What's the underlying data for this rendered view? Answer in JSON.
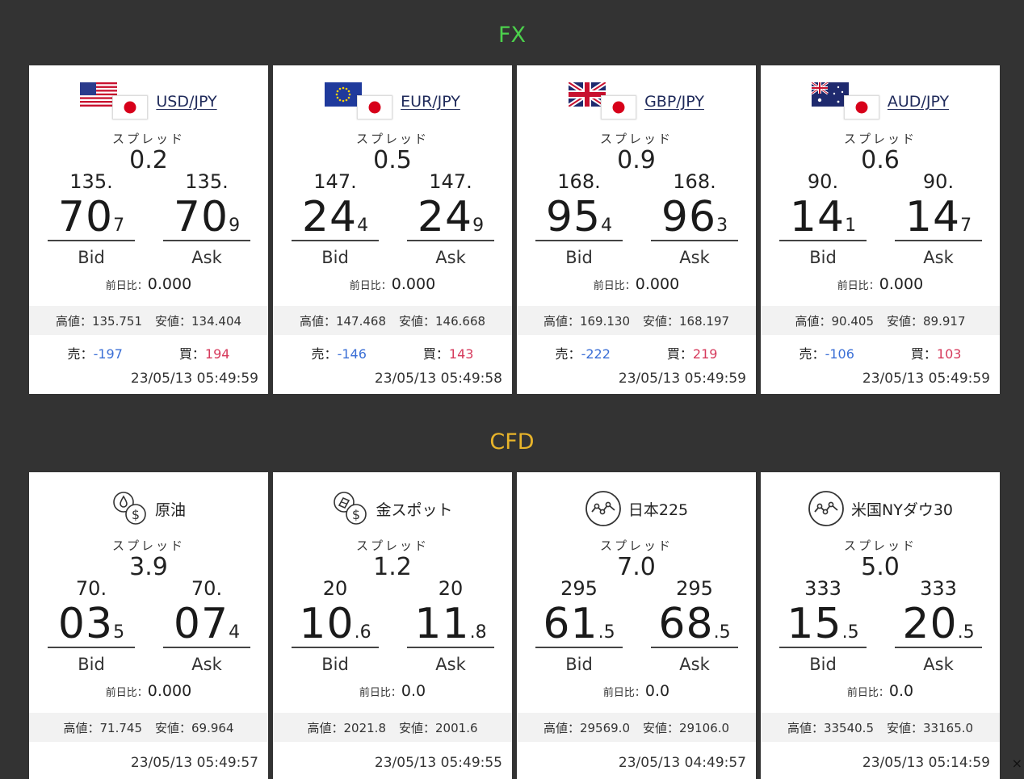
{
  "sections": {
    "fx_title": "FX",
    "cfd_title": "CFD"
  },
  "labels": {
    "spread": "スプレッド",
    "bid": "Bid",
    "ask": "Ask",
    "change": "前日比：",
    "high": "高値：",
    "low": "安値：",
    "sell": "売：",
    "buy": "買："
  },
  "fx": [
    {
      "pair": "USD/JPY",
      "spread": "0.2",
      "bid_prefix": "135.",
      "bid_main": "70",
      "bid_last": "7",
      "ask_prefix": "135.",
      "ask_main": "70",
      "ask_last": "9",
      "change": "0.000",
      "high": "135.751",
      "low": "134.404",
      "sell": "-197",
      "buy": "194",
      "time": "23/05/13 05:49:59"
    },
    {
      "pair": "EUR/JPY",
      "spread": "0.5",
      "bid_prefix": "147.",
      "bid_main": "24",
      "bid_last": "4",
      "ask_prefix": "147.",
      "ask_main": "24",
      "ask_last": "9",
      "change": "0.000",
      "high": "147.468",
      "low": "146.668",
      "sell": "-146",
      "buy": "143",
      "time": "23/05/13 05:49:58"
    },
    {
      "pair": "GBP/JPY",
      "spread": "0.9",
      "bid_prefix": "168.",
      "bid_main": "95",
      "bid_last": "4",
      "ask_prefix": "168.",
      "ask_main": "96",
      "ask_last": "3",
      "change": "0.000",
      "high": "169.130",
      "low": "168.197",
      "sell": "-222",
      "buy": "219",
      "time": "23/05/13 05:49:59"
    },
    {
      "pair": "AUD/JPY",
      "spread": "0.6",
      "bid_prefix": "90.",
      "bid_main": "14",
      "bid_last": "1",
      "ask_prefix": "90.",
      "ask_main": "14",
      "ask_last": "7",
      "change": "0.000",
      "high": "90.405",
      "low": "89.917",
      "sell": "-106",
      "buy": "103",
      "time": "23/05/13 05:49:59"
    }
  ],
  "cfd": [
    {
      "name": "原油",
      "icon": "oil-dollar-icon",
      "spread": "3.9",
      "bid_prefix": "70.",
      "bid_main": "03",
      "bid_last": "5",
      "ask_prefix": "70.",
      "ask_main": "07",
      "ask_last": "4",
      "change": "0.000",
      "high": "71.745",
      "low": "69.964",
      "time": "23/05/13 05:49:57"
    },
    {
      "name": "金スポット",
      "icon": "gold-dollar-icon",
      "spread": "1.2",
      "bid_prefix": "20",
      "bid_main": "10",
      "bid_last": ".6",
      "ask_prefix": "20",
      "ask_main": "11",
      "ask_last": ".8",
      "change": "0.0",
      "high": "2021.8",
      "low": "2001.6",
      "time": "23/05/13 05:49:55"
    },
    {
      "name": "日本225",
      "icon": "index-chart-icon",
      "spread": "7.0",
      "bid_prefix": "295",
      "bid_main": "61",
      "bid_last": ".5",
      "ask_prefix": "295",
      "ask_main": "68",
      "ask_last": ".5",
      "change": "0.0",
      "high": "29569.0",
      "low": "29106.0",
      "time": "23/05/13 04:49:57"
    },
    {
      "name": "米国NYダウ30",
      "icon": "index-chart-icon",
      "spread": "5.0",
      "bid_prefix": "333",
      "bid_main": "15",
      "bid_last": ".5",
      "ask_prefix": "333",
      "ask_main": "20",
      "ask_last": ".5",
      "change": "0.0",
      "high": "33540.5",
      "low": "33165.0",
      "time": "23/05/13 05:14:59"
    }
  ],
  "close_glyph": "×"
}
